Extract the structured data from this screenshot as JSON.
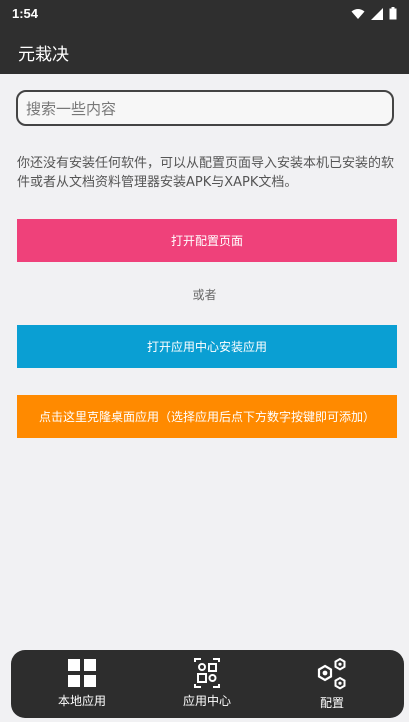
{
  "status": {
    "time": "1:54"
  },
  "appbar": {
    "title": "元栽决"
  },
  "search": {
    "placeholder": "搜索一些内容"
  },
  "main": {
    "info_text": "你还没有安装任何软件，可以从配置页面导入安装本机已安装的软件或者从文档资料管理器安装APK与XAPK文档。",
    "open_config_label": "打开配置页面",
    "or_label": "或者",
    "open_app_center_label": "打开应用中心安装应用",
    "clone_desktop_label": "点击这里克隆桌面应用（选择应用后点下方数字按键即可添加）"
  },
  "bottom_nav": {
    "items": [
      {
        "label": "本地应用",
        "icon": "grid-icon"
      },
      {
        "label": "应用中心",
        "icon": "app-center-icon"
      },
      {
        "label": "配置",
        "icon": "hexagon-settings-icon"
      }
    ]
  },
  "colors": {
    "bar_bg": "#2f2f2f",
    "pink_button": "#ef417a",
    "blue_button": "#0a9fd3",
    "orange_button": "#ff8a00"
  }
}
